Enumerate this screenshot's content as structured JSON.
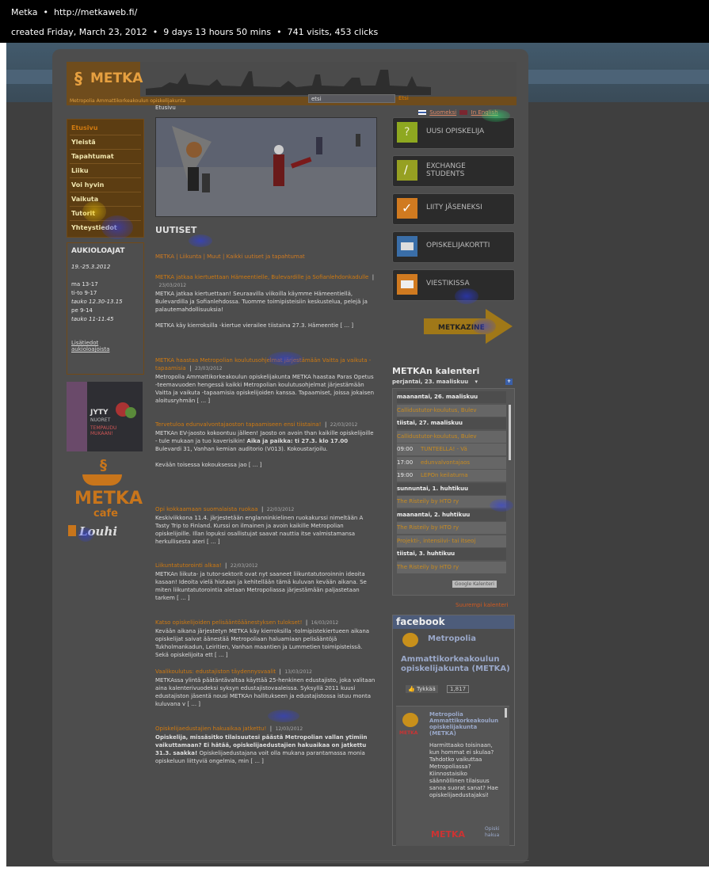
{
  "infobar": {
    "site": "Metka",
    "url": "http://metkaweb.fi/",
    "created": "created Friday, March 23, 2012",
    "duration": "9 days 13 hours 50 mins",
    "stats": "741 visits, 453 clicks",
    "separator": "•"
  },
  "header": {
    "logo_text": "METKA",
    "tagline": "Metropolia Ammattikorkeakoulun opiskelijakunta",
    "search_value": "etsi",
    "search_button": "Etsi",
    "breadcrumb": "Etusivu",
    "lang_fi": "Suomeksi",
    "lang_en": "In English"
  },
  "nav": {
    "items": [
      "Etusivu",
      "Yleistä",
      "Tapahtumat",
      "Liiku",
      "Voi hyvin",
      "Vaikuta",
      "Tutorit",
      "Yhteystiedot"
    ]
  },
  "hours": {
    "title": "AUKIOLOAJAT",
    "range": "19.-25.3.2012",
    "line1": "ma   13-17",
    "line2": "ti-to  9-17",
    "line3": "tauko 12.30-13.15",
    "line4": "pe    9-14",
    "line5": "tauko 11-11.45",
    "link1": "Lisätiedot",
    "link2": "aukioloajoista"
  },
  "banner": {
    "line1": "JYTY",
    "line2": "NUORET",
    "line3": "TEMPAUDU",
    "line4": "MUKAAN!"
  },
  "logos": {
    "cafe_name": "METKA",
    "cafe_sub": "cafe",
    "louhi": "Louhi"
  },
  "news": {
    "heading": "UUTISET",
    "filter": "METKA | Liikunta | Muut | Kaikki uutiset ja tapahtumat",
    "items": [
      {
        "title": "METKA jatkaa kiertuettaan Hämeentielle, Bulevardille ja Sofianlehdonkadulle",
        "date": "23/03/2012",
        "body": "METKA jatkaa kiertuettaan! Seuraavilla viikoilla käymme Hämeentiellä, Bulevardilla ja Sofianlehdossa. Tuomme toimipisteisiin keskustelua, pelejä ja palautemahdollisuuksia!",
        "extra": "METKA käy kierroksilla -kiertue vierailee tiistaina 27.3. Hämeentie [ ... ]"
      },
      {
        "title": "METKA haastaa Metropolian koulutusohjelmat järjestämään Vaitta ja vaikuta -tapaamisia",
        "date": "23/03/2012",
        "body": "Metropolia Ammattikorkeakoulun opiskelijakunta METKA haastaa Paras Opetus -teemavuoden hengessä kaikki Metropolian koulutusohjelmat järjestämään Vaitta ja vaikuta -tapaamisia opiskelijoiden kanssa. Tapaamiset, joissa jokaisen aloitusryhmän [ ... ]"
      },
      {
        "title": "Tervetuloa edunvalvontajaoston tapaamiseen ensi tiistaina!",
        "date": "22/03/2012",
        "body": "METKAn EV-jaosto kokoontuu jälleen! Jaosto on avoin than kaikille opiskelijoille - tule mukaan ja tuo kaverisikin!",
        "bold": "Aika ja paikka: ti 27.3. klo 17.00",
        "body2": "Bulevardi 31, Vanhan kemian auditorio (V013). Kokoustarjoilu.",
        "extra": "Kevään toisessa kokouksessa jao [ ... ]"
      },
      {
        "title": "Opi kokkaamaan suomalaista ruokaa",
        "date": "22/03/2012",
        "body": "Keskiviikkona 11.4. järjestetään englanninkielinen ruokakurssi nimeltään A Tasty Trip to Finland. Kurssi on ilmainen ja avoin kaikille Metropolian opiskelijoille. Illan lopuksi osallistujat saavat nauttia itse valmistamansa herkullisesta ateri [ ... ]"
      },
      {
        "title": "Liikuntatutorointi alkaa!",
        "date": "22/03/2012",
        "body": "METKAn liikuta- ja tutor-sektorit ovat nyt saaneet liikuntatutoroinnin ideoita kasaan! Ideoita vielä hiotaan ja kehitellään tämä kuluvan kevään aikana. Se miten liikuntatutorointia aletaan Metropoliassa järjestämään paljastetaan tarkem [ ... ]"
      },
      {
        "title": "Katso opiskelijoiden pelisääntöäänestyksen tulokset!",
        "date": "16/03/2012",
        "body": "Kevään aikana järjestetyn METKA käy kierroksilla -tolmipistekiertueen aikana opiskelijat saivat äänestää Metropoliaan haluamiaan pelisääntöjä Tukholmankadun, Leiritien, Vanhan maantien ja Lummetien toimipisteissä. Sekä opiskelijoita ett [ ... ]"
      },
      {
        "title": "Vaalikoulutus: edustajiston täydennysvaalit",
        "date": "13/03/2012",
        "body": "METKAssa ylintä päätäntävaltaa käyttää 25-henkinen edustajisto, joka valitaan aina kalenterivuodeksi syksyn edustajistovaaleissa. Syksyllä 2011 kuusi edustajiston jäsentä nousi METKAn hallitukseen ja edustajistossa istuu monta kuluvana v [ ... ]"
      },
      {
        "title": "Opiskelijaedustajien hakuaikaa jatkettu!",
        "date": "12/03/2012",
        "bold": "Opiskelija, missäsitko tilaisuutesi päästä Metropolian vallan ytimiin vaikuttamaan? Ei hätää, opiskelijaedustajien hakuaikaa on jatkettu 31.3. saakka!",
        "body": "Opiskelijaedustajana voit olla mukana parantamassa monia opiskeluun liittyviä ongelmia, min [ ... ]"
      }
    ]
  },
  "right": {
    "buttons": [
      {
        "label": "UUSI OPISKELIJA",
        "icon": "question-icon",
        "color": "#8ea820"
      },
      {
        "label": "EXCHANGE STUDENTS",
        "icon": "exchange-icon",
        "color": "#96a022"
      },
      {
        "label": "LIITY JÄSENEKSI",
        "icon": "checkmark-icon",
        "color": "#d07a20"
      },
      {
        "label": "OPISKELIJAKORTTI",
        "icon": "card-icon",
        "color": "#3a6ea8"
      },
      {
        "label": "VIESTIKISSA",
        "icon": "envelope-icon",
        "color": "#d07a20"
      }
    ],
    "zine": "METKAZINE"
  },
  "calendar": {
    "title": "METKAn kalenteri",
    "current_date": "perjantai, 23. maaliskuu",
    "rows": [
      {
        "type": "day",
        "text": "maanantai, 26. maaliskuu"
      },
      {
        "type": "ev",
        "time": "",
        "text": "Callidustutor-koulutus, Bulev"
      },
      {
        "type": "day",
        "text": "tiistai, 27. maaliskuu"
      },
      {
        "type": "ev",
        "time": "",
        "text": "Callidustutor-koulutus, Bulev"
      },
      {
        "type": "ev",
        "time": "09:00",
        "text": "TUNTEELLA! - Vä"
      },
      {
        "type": "ev",
        "time": "17:00",
        "text": "edunvalvontajaos"
      },
      {
        "type": "ev",
        "time": "19:00",
        "text": "LEPOn keilaturna"
      },
      {
        "type": "day",
        "text": "sunnuntai, 1. huhtikuu"
      },
      {
        "type": "ev",
        "time": "",
        "text": "The Risteily by HTO ry"
      },
      {
        "type": "day",
        "text": "maanantai, 2. huhtikuu"
      },
      {
        "type": "ev",
        "time": "",
        "text": "The Risteily by HTO ry"
      },
      {
        "type": "ev",
        "time": "",
        "text": "Projekti-, intensiivi- tai itseoj"
      },
      {
        "type": "day",
        "text": "tiistai, 3. huhtikuu"
      },
      {
        "type": "ev",
        "time": "",
        "text": "The Risteily by HTO ry"
      }
    ],
    "gcal_label": "Google Kalenteri",
    "bigger_label": "Suurempi kalenteri"
  },
  "facebook": {
    "header": "facebook",
    "page_name": "Metropolia",
    "org_name": "Ammattikorkeakoulun opiskelijakunta (METKA)",
    "like": "Tykkää",
    "like_count": "1,817",
    "post_name": "Metropolia Ammattikorkeakoulun opiskelijakunta (METKA)",
    "post_body": "Harmittaako toisinaan, kun hommat ei skulaa? Tahdotko vaikuttaa Metropoliassa? Kiinnostaisiko säännöllinen tilaisuus sanoa suorat sanat? Hae opiskelijaedustajaksi!",
    "post_logo": "METKA",
    "footer_logo": "METKA",
    "footer_side": "Opiski hakua"
  },
  "colors": {
    "infobar_bg": "#000000",
    "accent_orange": "#d07a10",
    "heat_blue": "#2233ff"
  }
}
